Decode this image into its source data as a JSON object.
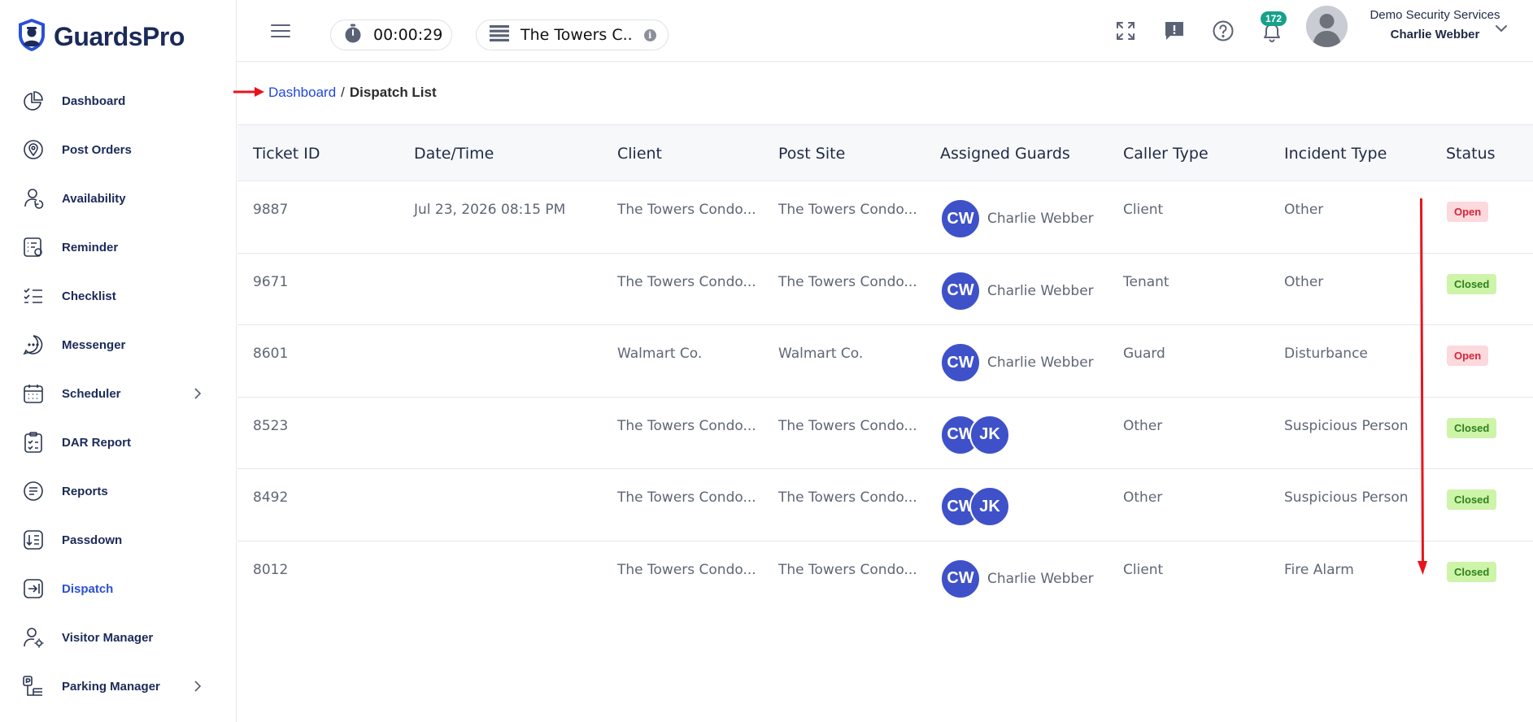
{
  "app": {
    "logo_text": "GuardsPro"
  },
  "sidebar": {
    "items": [
      {
        "label": "Dashboard",
        "icon": "pie-chart-icon",
        "active": false,
        "chevron": false
      },
      {
        "label": "Post Orders",
        "icon": "location-pin-icon",
        "active": false,
        "chevron": false
      },
      {
        "label": "Availability",
        "icon": "user-clock-icon",
        "active": false,
        "chevron": false
      },
      {
        "label": "Reminder",
        "icon": "reminder-list-icon",
        "active": false,
        "chevron": false
      },
      {
        "label": "Checklist",
        "icon": "checklist-icon",
        "active": false,
        "chevron": false
      },
      {
        "label": "Messenger",
        "icon": "chat-bubble-icon",
        "active": false,
        "chevron": false
      },
      {
        "label": "Scheduler",
        "icon": "calendar-icon",
        "active": false,
        "chevron": true
      },
      {
        "label": "DAR Report",
        "icon": "clipboard-check-icon",
        "active": false,
        "chevron": false
      },
      {
        "label": "Reports",
        "icon": "document-lines-icon",
        "active": false,
        "chevron": false
      },
      {
        "label": "Passdown",
        "icon": "sort-down-icon",
        "active": false,
        "chevron": false
      },
      {
        "label": "Dispatch",
        "icon": "dispatch-arrow-icon",
        "active": true,
        "chevron": false
      },
      {
        "label": "Visitor Manager",
        "icon": "user-gear-icon",
        "active": false,
        "chevron": false
      },
      {
        "label": "Parking Manager",
        "icon": "parking-icon",
        "active": false,
        "chevron": true
      }
    ]
  },
  "header": {
    "timer": "00:00:29",
    "site": "The Towers C..",
    "notifications_count": "172",
    "company": "Demo Security Services",
    "user": "Charlie Webber"
  },
  "breadcrumb": {
    "home": "Dashboard",
    "separator": "/",
    "current": "Dispatch List"
  },
  "table": {
    "columns": [
      "Ticket ID",
      "Date/Time",
      "Client",
      "Post Site",
      "Assigned Guards",
      "Caller Type",
      "Incident Type",
      "Status"
    ],
    "rows": [
      {
        "ticket": "9887",
        "datetime": "Jul 23, 2026 08:15 PM",
        "client": "The Towers Condo...",
        "site": "The Towers Condo...",
        "guards": [
          "CW"
        ],
        "guard_name": "Charlie Webber",
        "caller": "Client",
        "incident": "Other",
        "status": "Open"
      },
      {
        "ticket": "9671",
        "datetime": "",
        "client": "The Towers Condo...",
        "site": "The Towers Condo...",
        "guards": [
          "CW"
        ],
        "guard_name": "Charlie Webber",
        "caller": "Tenant",
        "incident": "Other",
        "status": "Closed"
      },
      {
        "ticket": "8601",
        "datetime": "",
        "client": "Walmart Co.",
        "site": "Walmart Co.",
        "guards": [
          "CW"
        ],
        "guard_name": "Charlie Webber",
        "caller": "Guard",
        "incident": "Disturbance",
        "status": "Open"
      },
      {
        "ticket": "8523",
        "datetime": "",
        "client": "The Towers Condo...",
        "site": "The Towers Condo...",
        "guards": [
          "CW",
          "JK"
        ],
        "guard_name": "",
        "caller": "Other",
        "incident": "Suspicious Person",
        "status": "Closed"
      },
      {
        "ticket": "8492",
        "datetime": "",
        "client": "The Towers Condo...",
        "site": "The Towers Condo...",
        "guards": [
          "CW",
          "JK"
        ],
        "guard_name": "",
        "caller": "Other",
        "incident": "Suspicious Person",
        "status": "Closed"
      },
      {
        "ticket": "8012",
        "datetime": "",
        "client": "The Towers Condo...",
        "site": "The Towers Condo...",
        "guards": [
          "CW"
        ],
        "guard_name": "Charlie Webber",
        "caller": "Client",
        "incident": "Fire Alarm",
        "status": "Closed"
      }
    ]
  },
  "colors": {
    "accent": "#2b4fd6",
    "avatar": "#3f51c9",
    "open_bg": "#fbd9dd",
    "open_fg": "#d6243a",
    "closed_bg": "#cdf4a8",
    "closed_fg": "#2f7f1c",
    "annotation": "#e8141c"
  }
}
